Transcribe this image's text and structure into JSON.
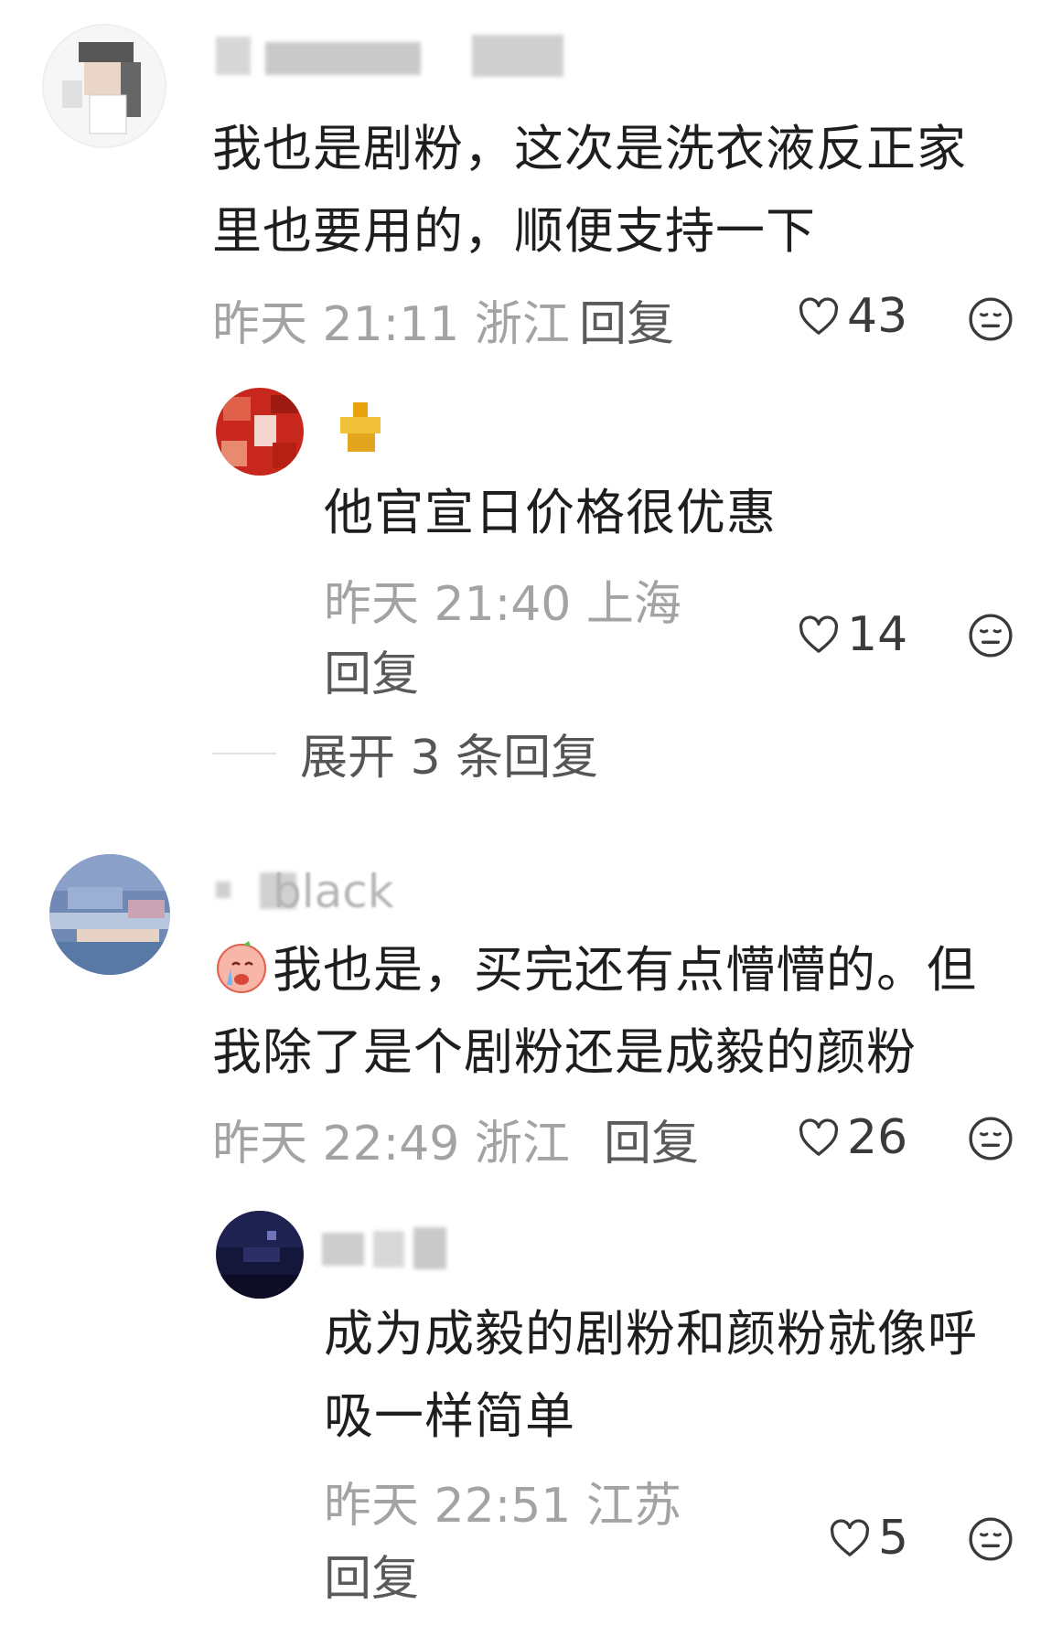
{
  "comments": [
    {
      "content_lines": [
        "我也是剧粉，这次是洗衣液反正家",
        "里也要用的，顺便支持一下"
      ],
      "time": "昨天 21:11",
      "location": "浙江",
      "reply_label": "回复",
      "likes": "43",
      "replies": [
        {
          "content_lines": [
            "他官宣日价格很优惠"
          ],
          "time": "昨天 21:40",
          "location": "上海",
          "reply_label": "回复",
          "likes": "14"
        }
      ],
      "expand_label": "展开 3 条回复"
    },
    {
      "username_visible": "black",
      "content_lines": [
        "我也是，买完还有点懵懵的。但",
        "我除了是个剧粉还是成毅的颜粉"
      ],
      "time": "昨天 22:49",
      "location": "浙江",
      "reply_label": "回复",
      "likes": "26",
      "replies": [
        {
          "content_lines": [
            "成为成毅的剧粉和颜粉就像呼",
            "吸一样简单"
          ],
          "time": "昨天 22:51",
          "location": "江苏",
          "reply_label": "回复",
          "likes": "5"
        }
      ]
    }
  ],
  "icons": {
    "like": "heart-outline-icon",
    "dislike": "neutral-face-icon"
  },
  "colors": {
    "text": "#1e1e1e",
    "meta": "#a3a3a3",
    "icon": "#3a3a3a"
  }
}
